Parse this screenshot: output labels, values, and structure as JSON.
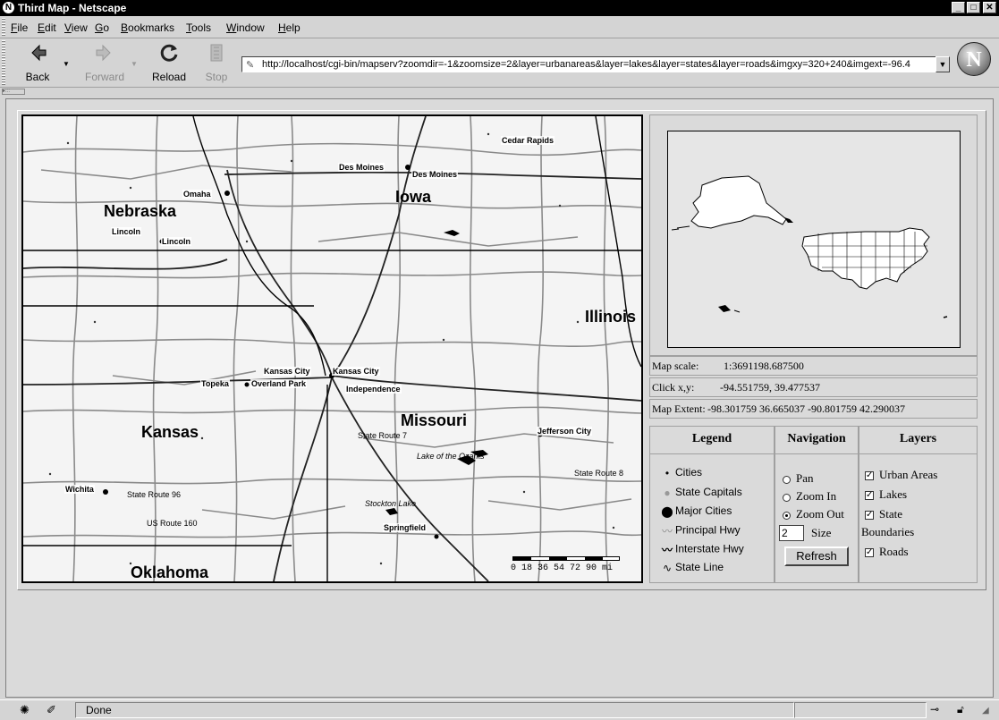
{
  "window": {
    "title": "Third Map - Netscape",
    "logo_letter": "N"
  },
  "menu": [
    {
      "label": "File",
      "key": "F",
      "rest": "ile"
    },
    {
      "label": "Edit",
      "key": "E",
      "rest": "dit"
    },
    {
      "label": "View",
      "key": "V",
      "rest": "iew"
    },
    {
      "label": "Go",
      "key": "G",
      "rest": "o"
    },
    {
      "label": "Bookmarks",
      "key": "B",
      "rest": "ookmarks"
    },
    {
      "label": "Tools",
      "key": "T",
      "rest": "ools"
    },
    {
      "label": "Window",
      "key": "W",
      "rest": "indow"
    },
    {
      "label": "Help",
      "key": "H",
      "rest": "elp"
    }
  ],
  "toolbar": {
    "back": "Back",
    "forward": "Forward",
    "reload": "Reload",
    "stop": "Stop",
    "url": "http://localhost/cgi-bin/mapserv?zoomdir=-1&zoomsize=2&layer=urbanareas&layer=lakes&layer=states&layer=roads&imgxy=320+240&imgext=-96.4"
  },
  "map": {
    "states": [
      "Nebraska",
      "Iowa",
      "Illinois",
      "Kansas",
      "Missouri",
      "Oklahoma"
    ],
    "cities": [
      "Cedar Rapids",
      "Des Moines",
      "Des Moines",
      "Omaha",
      "Lincoln",
      "Lincoln",
      "Kansas City",
      "Kansas City",
      "Topeka",
      "Overland Park",
      "Independence",
      "Jefferson City",
      "Wichita",
      "Springfield"
    ],
    "routes": [
      "State Route 7",
      "State Route 8",
      "State Route 96",
      "US Route 160"
    ],
    "lakes": [
      "Lake of the Ozarks",
      "Stockton Lake"
    ],
    "scale_ticks": "0  18  36  54  72  90 mi"
  },
  "info": {
    "map_scale_label": "Map scale:",
    "map_scale_value": "1:3691198.687500",
    "click_label": "Click x,y:",
    "click_value": "-94.551759, 39.477537",
    "extent_label": "Map Extent:",
    "extent_value": "-98.301759 36.665037 -90.801759 42.290037"
  },
  "legend": {
    "title": "Legend",
    "items": [
      "Cities",
      "State Capitals",
      "Major Cities",
      "Principal Hwy",
      "Interstate Hwy",
      "State Line"
    ]
  },
  "navigation": {
    "title": "Navigation",
    "options": [
      "Pan",
      "Zoom In",
      "Zoom Out"
    ],
    "selected": "Zoom Out",
    "size_value": "2",
    "size_label": "Size",
    "refresh": "Refresh"
  },
  "layers": {
    "title": "Layers",
    "items": [
      "Urban Areas",
      "Lakes",
      "State",
      "Boundaries",
      "Roads"
    ]
  },
  "status": {
    "text": "Done"
  }
}
